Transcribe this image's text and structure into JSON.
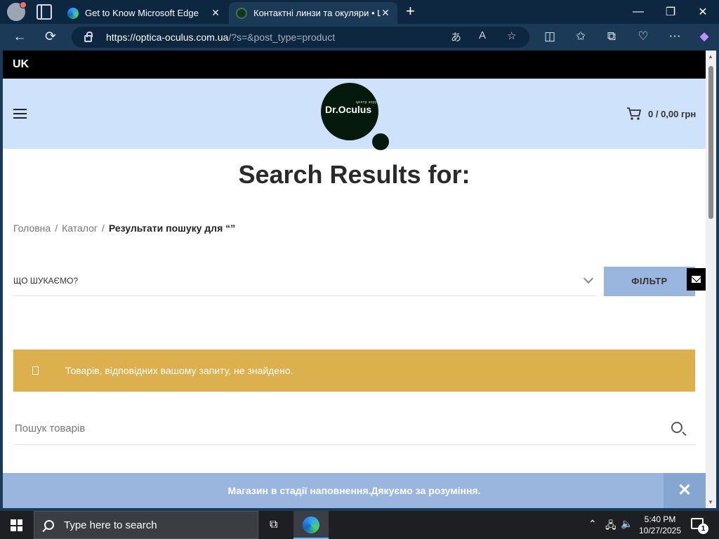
{
  "browser": {
    "tabs": [
      {
        "title": "Get to Know Microsoft Edge",
        "close": "✕"
      },
      {
        "title": "Контактні линзи та окуляри • Це",
        "close": "✕"
      }
    ],
    "new_tab": "+",
    "window_controls": {
      "minimize": "—",
      "restore": "❐",
      "close": "✕"
    },
    "url_host": "https://optica-oculus.com.ua",
    "url_path": "/?s=&post_type=product",
    "icons": [
      "back-arrow-icon",
      "refresh-icon",
      "lock-icon",
      "translate-icon",
      "read-aloud-icon",
      "favorite-star-icon",
      "split-screen-icon",
      "favorites-icon",
      "collections-icon",
      "browser-essentials-icon",
      "more-menu-icon",
      "copilot-icon"
    ]
  },
  "site": {
    "lang": "UK",
    "logo_sub": "центр зору",
    "logo_name": "Dr.Oculus",
    "cart_text": "0 / 0,00 грн",
    "page_title": "Search Results for:",
    "breadcrumb": {
      "home": "Головна",
      "catalog": "Каталог",
      "sep": "/",
      "current": "Результати пошуку для “”"
    },
    "filter_placeholder": "ЩО ШУКАЄМО?",
    "filter_button": "ФІЛЬТР",
    "notice": "Товарів, відповідних вашому запиту, не знайдено.",
    "search_placeholder": "Пошук товарів",
    "store_banner": "Магазин в стадії наповнення.Дякуємо за розуміння.",
    "banner_close": "✕"
  },
  "taskbar": {
    "search_placeholder": "Type here to search",
    "time": "5:40 PM",
    "date": "10/27/2025",
    "notification_count": "1"
  },
  "colors": {
    "header_bg": "#cfe2fb",
    "notice_bg": "#dcb04c",
    "filter_btn": "#9ab6df",
    "browser_frame": "#1b3a57"
  }
}
